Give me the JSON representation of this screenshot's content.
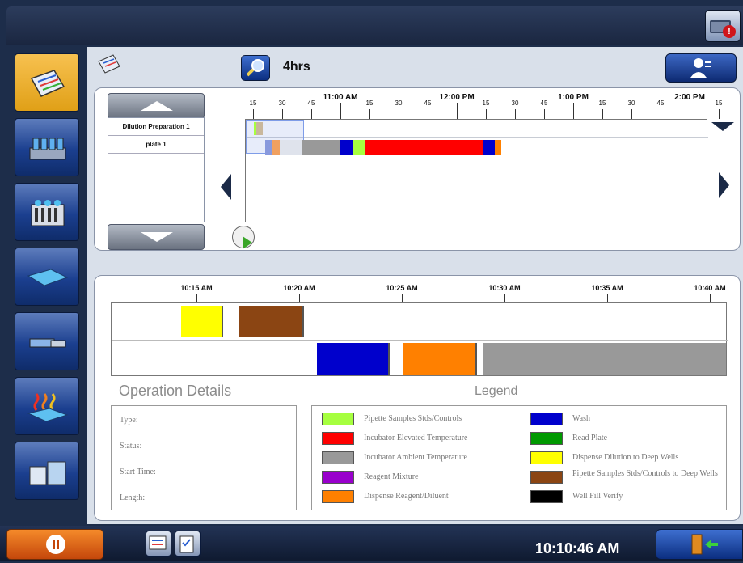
{
  "header": {
    "alert_icon": "computer-alert-icon"
  },
  "sidebar": {
    "items": [
      {
        "name": "schedule",
        "icon": "schedule-board-icon",
        "active": true
      },
      {
        "name": "reagents",
        "icon": "reagent-bottles-icon",
        "active": false
      },
      {
        "name": "samples",
        "icon": "sample-rack-icon",
        "active": false
      },
      {
        "name": "plates",
        "icon": "plate-icon",
        "active": false
      },
      {
        "name": "washer",
        "icon": "washer-icon",
        "active": false
      },
      {
        "name": "incubator",
        "icon": "incubator-heat-icon",
        "active": false
      },
      {
        "name": "storage",
        "icon": "storage-icon",
        "active": false
      }
    ]
  },
  "toolbar": {
    "zoom_label": "4hrs"
  },
  "gantt": {
    "plates": [
      "Dilution Preparation 1",
      "plate 1"
    ],
    "ticks": [
      {
        "label": "15",
        "hour": false
      },
      {
        "label": "30",
        "hour": false
      },
      {
        "label": "45",
        "hour": false
      },
      {
        "label": "11:00 AM",
        "hour": true
      },
      {
        "label": "15",
        "hour": false
      },
      {
        "label": "30",
        "hour": false
      },
      {
        "label": "45",
        "hour": false
      },
      {
        "label": "12:00 PM",
        "hour": true
      },
      {
        "label": "15",
        "hour": false
      },
      {
        "label": "30",
        "hour": false
      },
      {
        "label": "45",
        "hour": false
      },
      {
        "label": "1:00 PM",
        "hour": true
      },
      {
        "label": "15",
        "hour": false
      },
      {
        "label": "30",
        "hour": false
      },
      {
        "label": "45",
        "hour": false
      },
      {
        "label": "2:00 PM",
        "hour": true
      },
      {
        "label": "15",
        "hour": false
      }
    ]
  },
  "detail": {
    "ticks": [
      "10:15 AM",
      "10:20 AM",
      "10:25 AM",
      "10:30 AM",
      "10:35 AM",
      "10:40 AM"
    ]
  },
  "operation_details": {
    "title": "Operation Details",
    "fields": [
      "Type:",
      "Status:",
      "Start Time:",
      "Length:"
    ]
  },
  "legend": {
    "title": "Legend",
    "items": [
      {
        "label": "Pipette Samples Stds/Controls",
        "color": "#a6ff3f"
      },
      {
        "label": "Incubator Elevated Temperature",
        "color": "#ff0000"
      },
      {
        "label": "Incubator Ambient Temperature",
        "color": "#999999"
      },
      {
        "label": "Reagent Mixture",
        "color": "#9900cc"
      },
      {
        "label": "Dispense Reagent/Diluent",
        "color": "#ff8000"
      },
      {
        "label": "Wash",
        "color": "#0000cc"
      },
      {
        "label": "Read Plate",
        "color": "#009900"
      },
      {
        "label": "Dispense Dilution to Deep Wells",
        "color": "#ffff00"
      },
      {
        "label": "Pipette Samples Stds/Controls to Deep Wells",
        "color": "#8b4513"
      },
      {
        "label": "Well Fill Verify",
        "color": "#000000"
      }
    ]
  },
  "footer": {
    "clock": "10:10:46 AM"
  }
}
